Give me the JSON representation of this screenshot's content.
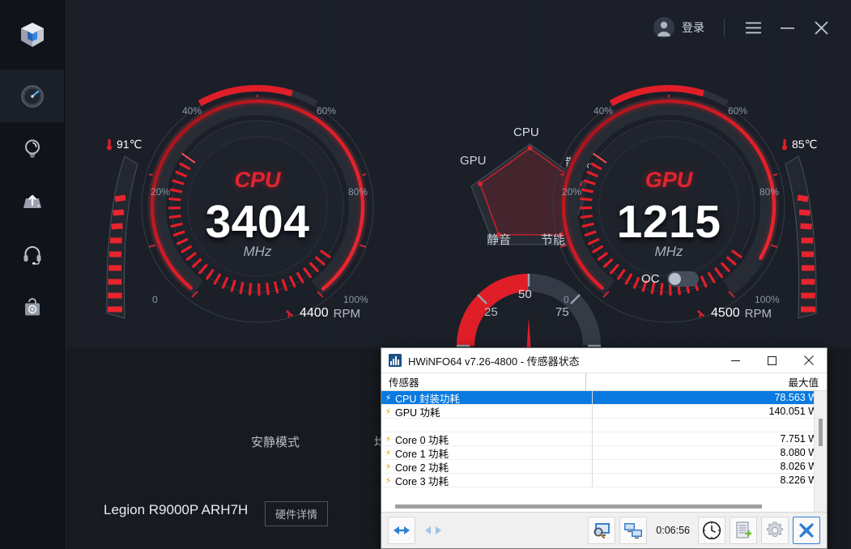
{
  "header": {
    "login_label": "登录",
    "menu_icon": "hamburger-menu-icon",
    "minimize_icon": "minimize-icon",
    "close_icon": "close-icon",
    "avatar_icon": "user-avatar-icon"
  },
  "sidebar": {
    "logo_icon": "legion-cube-logo",
    "items": [
      {
        "icon": "dashboard-gauge-icon",
        "active": true
      },
      {
        "icon": "lightbulb-icon",
        "active": false
      },
      {
        "icon": "upgrade-tray-icon",
        "active": false
      },
      {
        "icon": "headset-support-icon",
        "active": false
      },
      {
        "icon": "shopping-bag-icon",
        "active": false
      }
    ]
  },
  "cpu_gauge": {
    "title": "CPU",
    "value": "3404",
    "unit": "MHz",
    "fan_rpm": "4400",
    "fan_unit": "RPM",
    "fan_icon": "fan-icon",
    "temperature": "91℃",
    "temp_icon": "thermometer-icon",
    "ticks": [
      "20%",
      "40%",
      "60%",
      "80%",
      "100%",
      "0"
    ],
    "load_percent": 52,
    "temp_bar_percent": 72
  },
  "gpu_gauge": {
    "title": "GPU",
    "value": "1215",
    "unit": "MHz",
    "fan_rpm": "4500",
    "fan_unit": "RPM",
    "fan_icon": "fan-icon",
    "temperature": "85℃",
    "temp_icon": "thermometer-icon",
    "ticks": [
      "20%",
      "40%",
      "60%",
      "80%",
      "100%",
      "0"
    ],
    "oc_label": "OC",
    "oc_enabled": false,
    "load_percent": 52,
    "temp_bar_percent": 68
  },
  "radar": {
    "labels": [
      "CPU",
      "散热",
      "节能",
      "静音",
      "GPU"
    ],
    "active_label": "CPU",
    "accent_color": "#c0222c"
  },
  "dial": {
    "ticks": [
      "25",
      "50",
      "75"
    ],
    "value": 50
  },
  "footer": {
    "mode_label": "安静模式",
    "partial_label": "均",
    "device_name": "Legion R9000P ARH7H",
    "hardware_detail_label": "硬件详情"
  },
  "hwinfo": {
    "title": "HWiNFO64 v7.26-4800 - 传感器状态",
    "app_icon": "hwinfo-icon",
    "window_buttons": {
      "minimize": "minimize-icon",
      "maximize": "maximize-icon",
      "close": "close-icon"
    },
    "columns": {
      "sensor": "传感器",
      "max": "最大值"
    },
    "rows": [
      {
        "name": "CPU 封装功耗",
        "max": "78.563 W",
        "selected": true,
        "blank": false
      },
      {
        "name": "GPU 功耗",
        "max": "140.051 W",
        "selected": false,
        "blank": false
      },
      {
        "name": "",
        "max": "",
        "selected": false,
        "blank": true
      },
      {
        "name": "Core 0 功耗",
        "max": "7.751 W",
        "selected": false,
        "blank": false
      },
      {
        "name": "Core 1 功耗",
        "max": "8.080 W",
        "selected": false,
        "blank": false
      },
      {
        "name": "Core 2 功耗",
        "max": "8.026 W",
        "selected": false,
        "blank": false
      },
      {
        "name": "Core 3 功耗",
        "max": "8.226 W",
        "selected": false,
        "blank": false
      }
    ],
    "toolbar": {
      "expand_icon": "expand-arrows-icon",
      "collapse_icon": "collapse-arrows-icon",
      "monitor_search_icon": "monitor-search-icon",
      "remote_monitor_icon": "remote-monitors-icon",
      "timer": "0:06:56",
      "clock_icon": "clock-icon",
      "logging_icon": "add-log-file-icon",
      "settings_icon": "gear-icon",
      "close_icon": "close-x-icon"
    }
  }
}
